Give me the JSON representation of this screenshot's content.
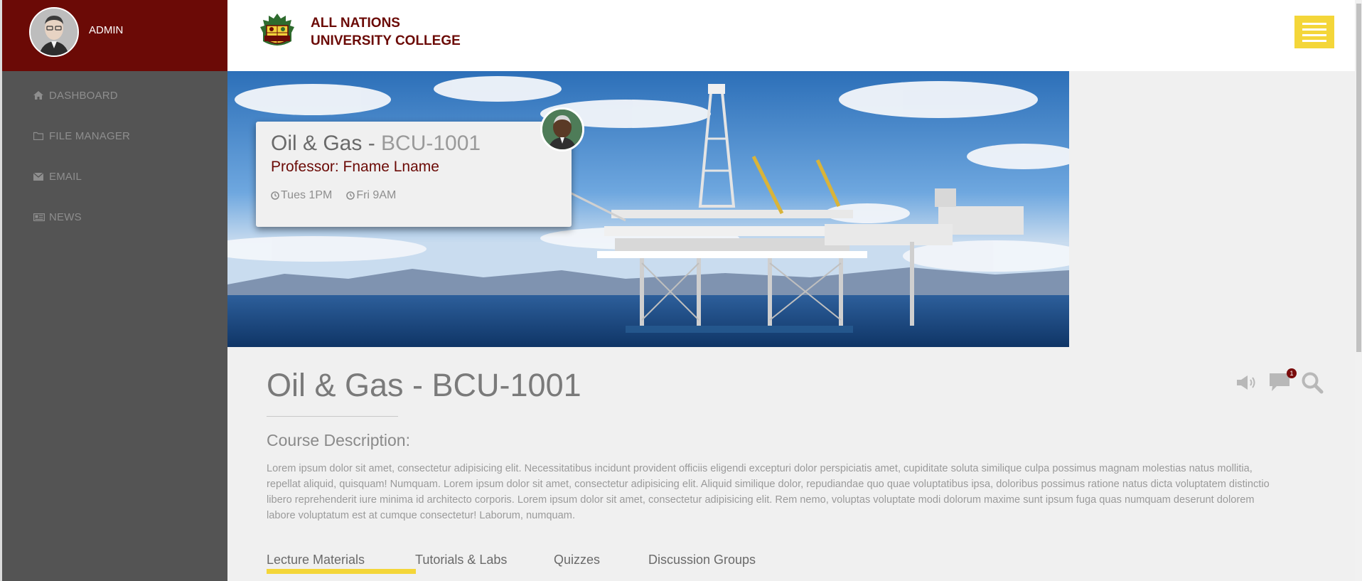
{
  "sidebar": {
    "user_label": "ADMIN",
    "items": [
      {
        "label": "DASHBOARD",
        "icon": "home-icon"
      },
      {
        "label": "FILE MANAGER",
        "icon": "folder-icon"
      },
      {
        "label": "EMAIL",
        "icon": "envelope-icon"
      },
      {
        "label": "NEWS",
        "icon": "newspaper-icon"
      }
    ]
  },
  "header": {
    "college_line1": "ALL NATIONS",
    "college_line2": "UNIVERSITY COLLEGE",
    "logo_text": "ANUC"
  },
  "banner": {
    "card": {
      "title_name": "Oil & Gas - ",
      "title_code": "BCU-1001",
      "professor": "Professor: Fname Lname",
      "times": [
        "Tues 1PM",
        "Fri 9AM"
      ]
    }
  },
  "course": {
    "title": "Oil & Gas - BCU-1001",
    "description_heading": "Course Description:",
    "description": "Lorem ipsum dolor sit amet, consectetur adipisicing elit. Necessitatibus incidunt provident officiis eligendi excepturi dolor perspiciatis amet, cupiditate soluta similique culpa possimus magnam molestias natus mollitia, repellat aliquid, quisquam! Numquam. Lorem ipsum dolor sit amet, consectetur adipisicing elit. Aliquid similique dolor, repudiandae quo quae voluptatibus ipsa, doloribus possimus ratione natus dicta voluptatem distinctio libero reprehenderit iure minima id architecto corporis. Lorem ipsum dolor sit amet, consectetur adipisicing elit. Rem nemo, voluptas voluptate modi dolorum maxime sunt ipsum fuga quas numquam deserunt dolorem labore voluptatum est at cumque consectetur! Laborum, numquam.",
    "notification_count": "1"
  },
  "tabs": [
    {
      "label": "Lecture Materials",
      "active": true
    },
    {
      "label": "Tutorials & Labs",
      "active": false
    },
    {
      "label": "Quizzes",
      "active": false
    },
    {
      "label": "Discussion Groups",
      "active": false
    }
  ],
  "colors": {
    "brand": "#6b0a06",
    "accent": "#f4d639",
    "sidebar_bg": "#545454"
  }
}
